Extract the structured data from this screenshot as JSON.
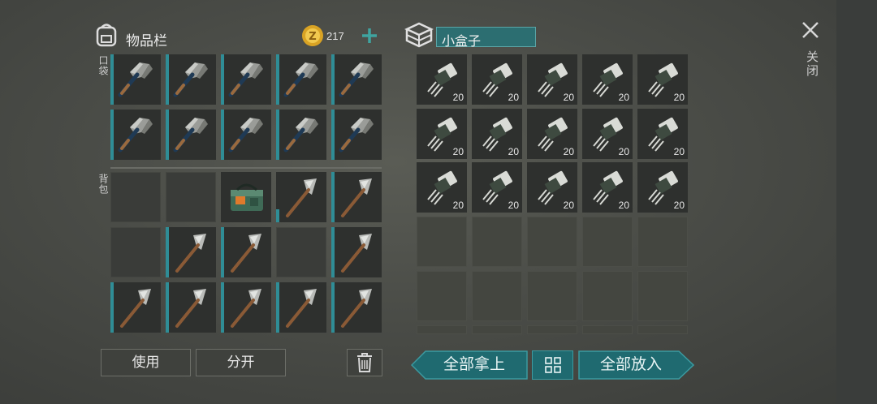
{
  "inventory": {
    "title": "物品栏",
    "coin_icon": "coin-icon",
    "coins": "217",
    "add_icon": "plus-icon",
    "pocket_label": "口袋",
    "backpack_label": "背包",
    "use_label": "使用",
    "split_label": "分开",
    "trash_icon": "trash-icon"
  },
  "container": {
    "name": "小盒子",
    "box_icon": "box-icon",
    "item_qty": [
      "20",
      "20",
      "20",
      "20",
      "20",
      "20",
      "20",
      "20",
      "20",
      "20",
      "20",
      "20",
      "20",
      "20",
      "20"
    ]
  },
  "actions": {
    "take_all": "全部拿上",
    "sort_icon": "sort-grid-icon",
    "put_all": "全部放入"
  },
  "close": {
    "icon": "close-x-icon",
    "label": "关闭"
  },
  "colors": {
    "accent": "#2f8d96",
    "teal_button": "#1f6a70",
    "name_field": "#2c6e71"
  }
}
